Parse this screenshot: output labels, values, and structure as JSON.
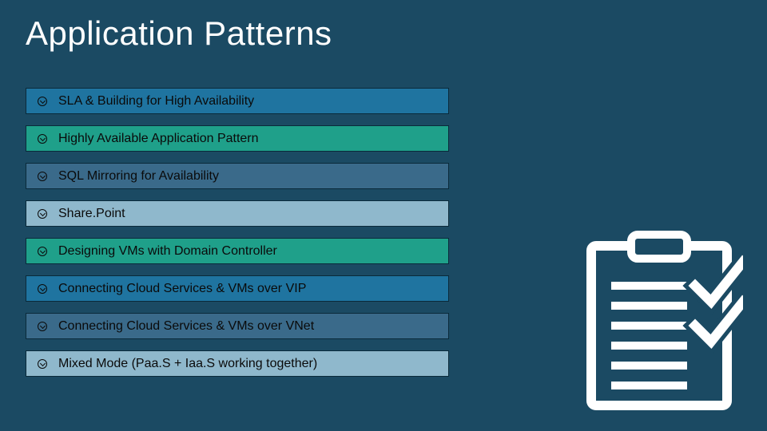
{
  "title": "Application Patterns",
  "items": [
    {
      "label": "SLA & Building for High Availability",
      "color": "bar-blue"
    },
    {
      "label": "Highly Available Application Pattern",
      "color": "bar-teal"
    },
    {
      "label": "SQL Mirroring for Availability",
      "color": "bar-steel"
    },
    {
      "label": "Share.Point",
      "color": "bar-light"
    },
    {
      "label": "Designing VMs with Domain Controller",
      "color": "bar-teal"
    },
    {
      "label": "Connecting Cloud Services & VMs over VIP",
      "color": "bar-blue"
    },
    {
      "label": "Connecting Cloud Services & VMs over VNet",
      "color": "bar-steel"
    },
    {
      "label": "Mixed Mode (Paa.S + Iaa.S working together)",
      "color": "bar-light"
    }
  ]
}
